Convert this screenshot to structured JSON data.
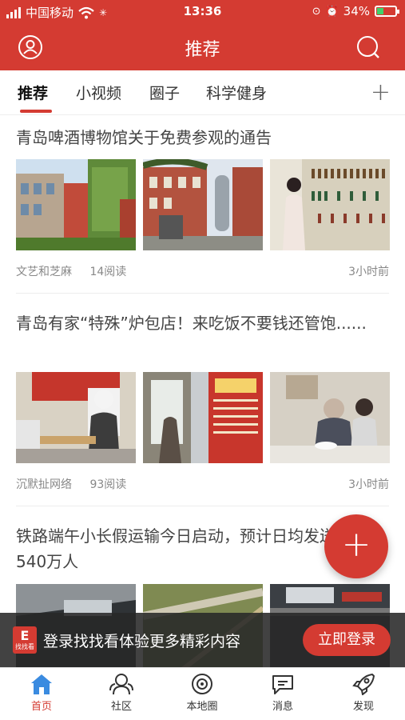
{
  "status_bar": {
    "carrier": "中国移动",
    "time": "13:36",
    "battery": "34%"
  },
  "header": {
    "title": "推荐",
    "user_icon": "user-icon",
    "search_icon": "search-icon"
  },
  "tabs": [
    {
      "label": "推荐",
      "active": true
    },
    {
      "label": "小视频",
      "active": false
    },
    {
      "label": "圈子",
      "active": false
    },
    {
      "label": "科学健身",
      "active": false
    }
  ],
  "add_tab_symbol": "+",
  "articles": [
    {
      "title": "青岛啤酒博物馆关于免费参观的通告",
      "source": "文艺和芝麻",
      "reads": "14阅读",
      "time": "3小时前"
    },
    {
      "title": "青岛有家“特殊”炉包店！来吃饭不要钱还管饱......",
      "source": "沉默扯网络",
      "reads": "93阅读",
      "time": "3小时前"
    },
    {
      "title": "铁路端午小长假运输今日启动，预计日均发送旅客 540万人"
    }
  ],
  "banner": {
    "logo_text": "找找看",
    "text": "登录找找看体验更多精彩内容",
    "button": "立即登录"
  },
  "fab_symbol": "+",
  "bottom_nav": [
    {
      "label": "首页",
      "icon": "home-icon",
      "active": true
    },
    {
      "label": "社区",
      "icon": "community-icon",
      "active": false
    },
    {
      "label": "本地圈",
      "icon": "local-circle-icon",
      "active": false
    },
    {
      "label": "消息",
      "icon": "message-icon",
      "active": false
    },
    {
      "label": "发现",
      "icon": "rocket-icon",
      "active": false
    }
  ],
  "colors": {
    "brand": "#d43b32",
    "banner_bg": "#282828"
  }
}
